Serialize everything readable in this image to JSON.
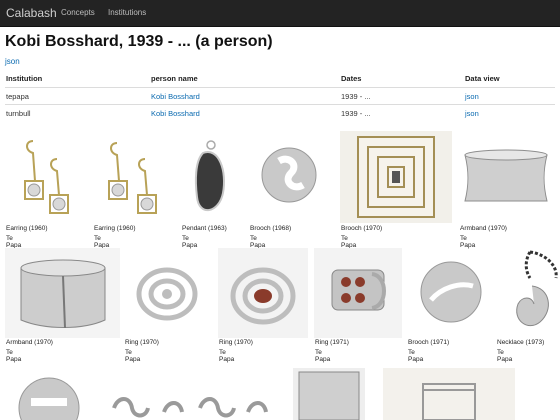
{
  "nav": {
    "brand": "Calabash",
    "links": [
      "Concepts",
      "Institutions"
    ]
  },
  "page": {
    "title": "Kobi Bosshard, 1939 - ... (a person)",
    "json_link": "json"
  },
  "table": {
    "headers": [
      "Institution",
      "person name",
      "Dates",
      "Data view"
    ],
    "rows": [
      [
        "tepapa",
        "Kobi Bosshard",
        "1939 - ...",
        "json"
      ],
      [
        "turnbull",
        "Kobi Bosshard",
        "1939 - ...",
        "json"
      ]
    ]
  },
  "items": [
    {
      "caption": "Earring (1960)",
      "org": "Te Papa"
    },
    {
      "caption": "Earring (1960)",
      "org": "Te Papa"
    },
    {
      "caption": "Pendant (1963)",
      "org": "Te Papa"
    },
    {
      "caption": "Brooch (1968)",
      "org": "Te Papa"
    },
    {
      "caption": "Brooch (1970)",
      "org": "Te Papa"
    },
    {
      "caption": "Armband (1970)",
      "org": "Te Papa"
    },
    {
      "caption": "Armband (1970)",
      "org": "Te Papa"
    },
    {
      "caption": "Ring (1970)",
      "org": "Te Papa"
    },
    {
      "caption": "Ring (1970)",
      "org": "Te Papa"
    },
    {
      "caption": "Ring (1971)",
      "org": "Te Papa"
    },
    {
      "caption": "Brooch (1971)",
      "org": "Te Papa"
    },
    {
      "caption": "Necklace (1973)",
      "org": "Te Papa"
    }
  ],
  "colors": {
    "navbar": "#232323",
    "link": "#0a6ab0",
    "metal": "#bcbcbc",
    "gold": "#b8a257",
    "stone": "#8a3b2b"
  }
}
